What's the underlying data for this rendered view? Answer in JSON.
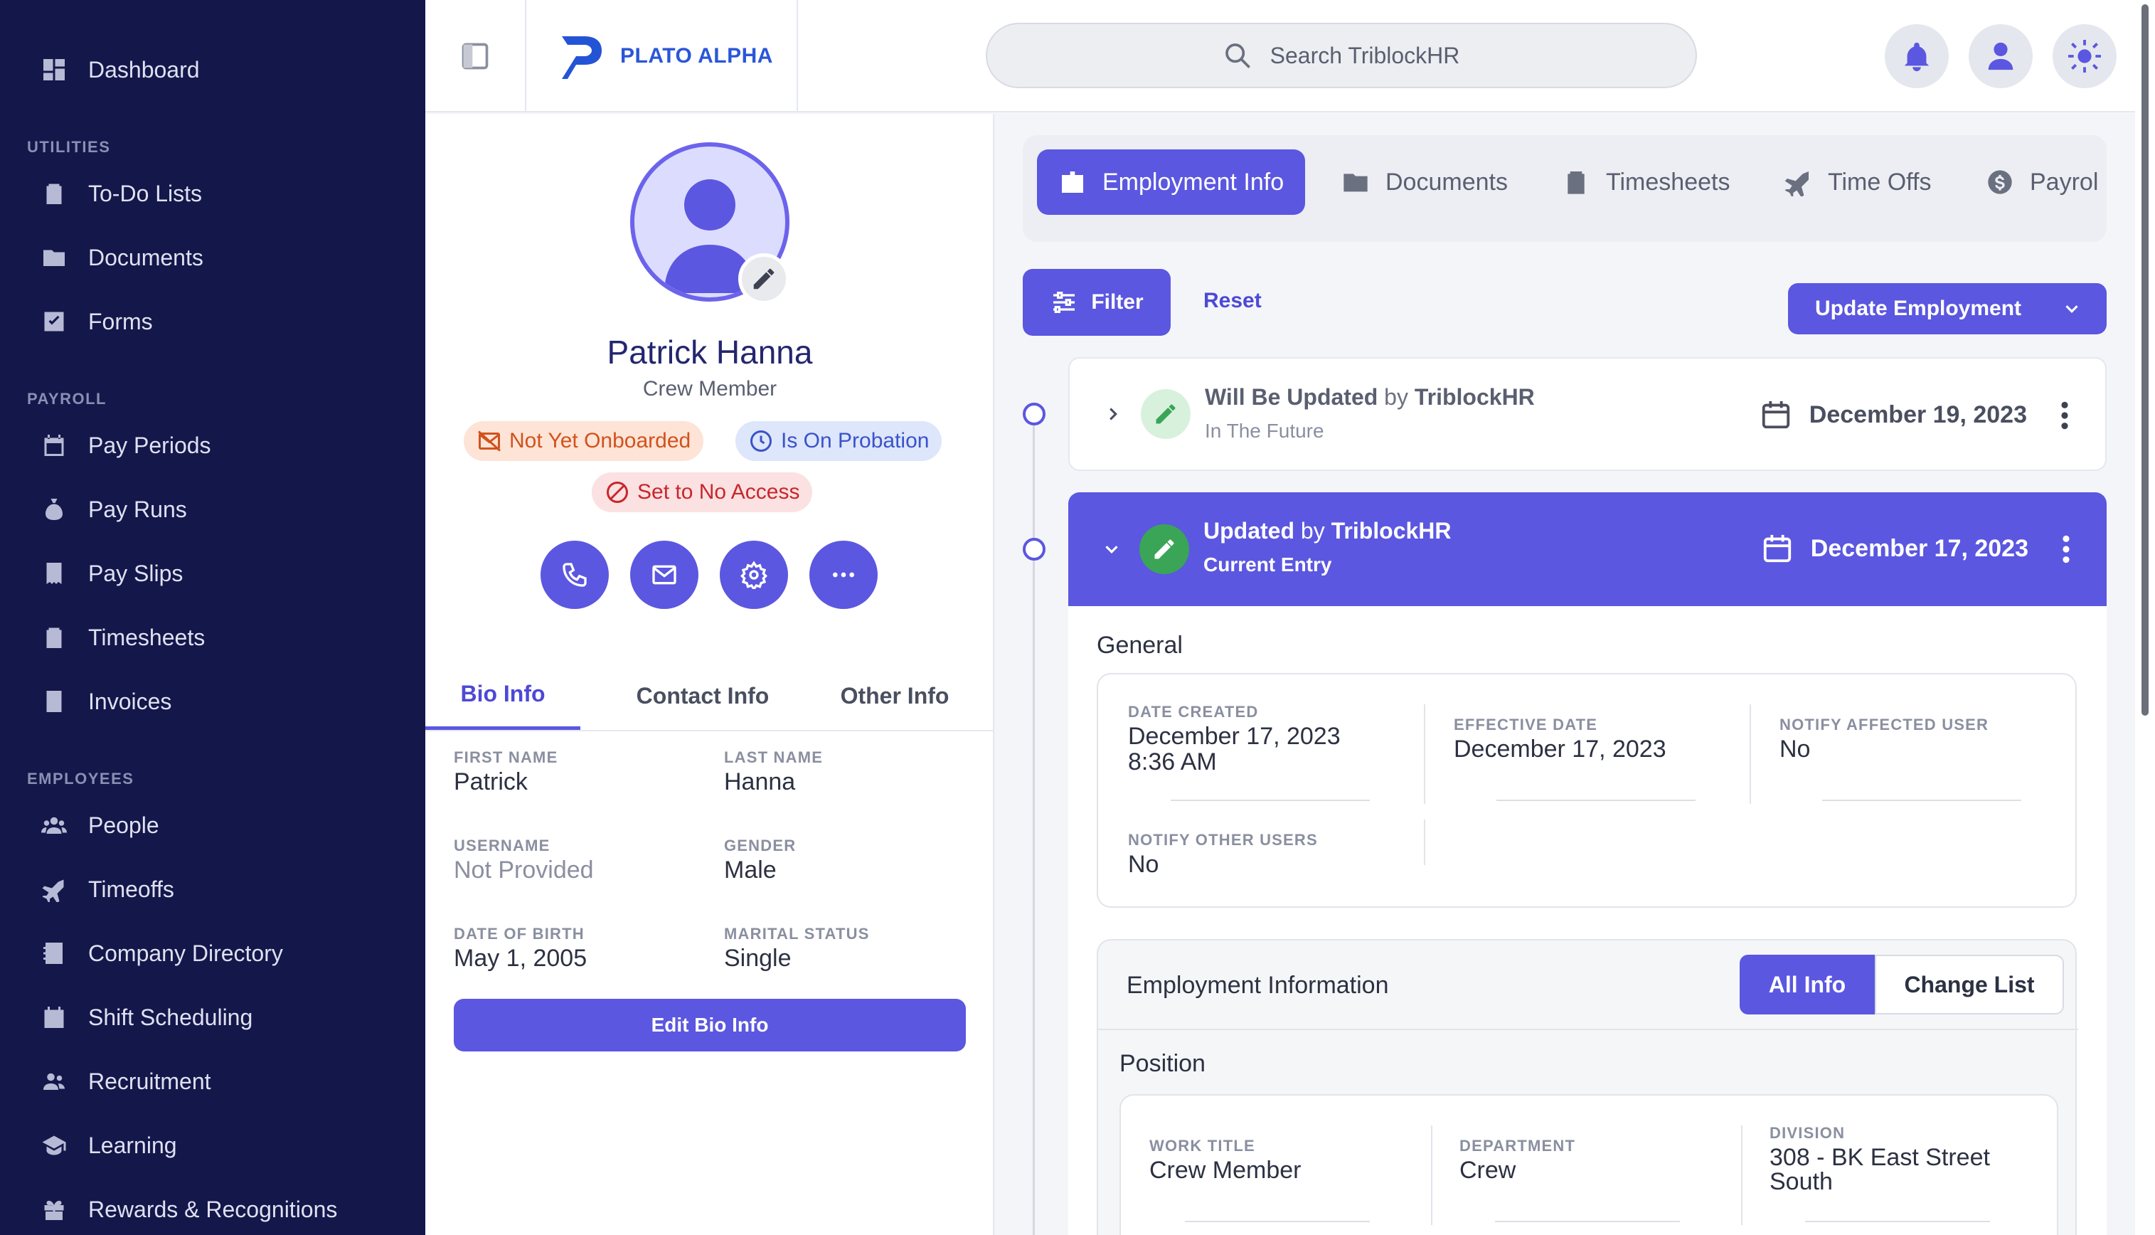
{
  "sidebar": {
    "dashboard": "Dashboard",
    "sections": {
      "utilities": "UTILITIES",
      "payroll": "PAYROLL",
      "employees": "EMPLOYEES"
    },
    "utilities": [
      "To-Do Lists",
      "Documents",
      "Forms"
    ],
    "payroll": [
      "Pay Periods",
      "Pay Runs",
      "Pay Slips",
      "Timesheets",
      "Invoices"
    ],
    "employees": [
      "People",
      "Timeoffs",
      "Company Directory",
      "Shift Scheduling",
      "Recruitment",
      "Learning",
      "Rewards & Recognitions"
    ]
  },
  "header": {
    "logo_text": "PLATO ALPHA",
    "search_placeholder": "Search TriblockHR"
  },
  "profile": {
    "name": "Patrick Hanna",
    "role": "Crew Member",
    "badges": {
      "onboarded": "Not Yet Onboarded",
      "probation": "Is On Probation",
      "access": "Set to No Access"
    },
    "tabs": [
      "Bio Info",
      "Contact Info",
      "Other Info"
    ],
    "fields": {
      "first_name_label": "FIRST NAME",
      "first_name": "Patrick",
      "last_name_label": "LAST NAME",
      "last_name": "Hanna",
      "username_label": "USERNAME",
      "username": "Not Provided",
      "gender_label": "GENDER",
      "gender": "Male",
      "dob_label": "DATE OF BIRTH",
      "dob": "May 1, 2005",
      "marital_label": "MARITAL STATUS",
      "marital": "Single"
    },
    "edit_button": "Edit Bio Info"
  },
  "content": {
    "tabs": [
      "Employment Info",
      "Documents",
      "Timesheets",
      "Time Offs",
      "Payrol"
    ],
    "filter": "Filter",
    "reset": "Reset",
    "update_button": "Update Employment",
    "entries": [
      {
        "title": "Will Be Updated",
        "by": "by",
        "author": "TriblockHR",
        "sub": "In The Future",
        "date": "December 19, 2023"
      },
      {
        "title": "Updated",
        "by": "by",
        "author": "TriblockHR",
        "sub": "Current Entry",
        "date": "December 17, 2023"
      }
    ],
    "general": {
      "title": "General",
      "date_created_label": "DATE CREATED",
      "date_created": "December 17, 2023",
      "time_created": "8:36 AM",
      "effective_date_label": "EFFECTIVE DATE",
      "effective_date": "December 17, 2023",
      "notify_affected_label": "NOTIFY AFFECTED USER",
      "notify_affected": "No",
      "notify_other_label": "NOTIFY OTHER USERS",
      "notify_other": "No"
    },
    "employment": {
      "title": "Employment Information",
      "all_info": "All Info",
      "change_list": "Change List",
      "position_title": "Position",
      "work_title_label": "WORK TITLE",
      "work_title": "Crew Member",
      "department_label": "DEPARTMENT",
      "department": "Crew",
      "division_label": "DIVISION",
      "division_line1": "308 - BK East Street",
      "division_line2": "South"
    }
  },
  "colors": {
    "accent": "#5b57e0",
    "sidebar_bg": "#14174a",
    "success": "#3aa556"
  }
}
